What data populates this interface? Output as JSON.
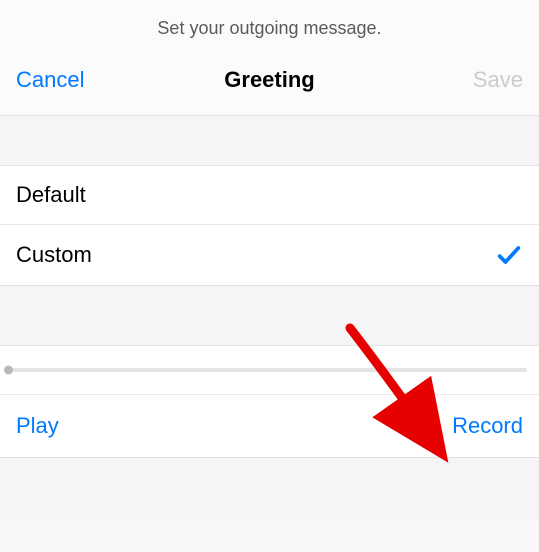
{
  "instruction": "Set your outgoing message.",
  "nav": {
    "cancel": "Cancel",
    "title": "Greeting",
    "save": "Save"
  },
  "options": {
    "default_label": "Default",
    "custom_label": "Custom",
    "selected": "custom"
  },
  "controls": {
    "play": "Play",
    "record": "Record"
  },
  "progress": {
    "value": 0
  },
  "colors": {
    "accent": "#007aff",
    "disabled": "#cbcbce"
  }
}
